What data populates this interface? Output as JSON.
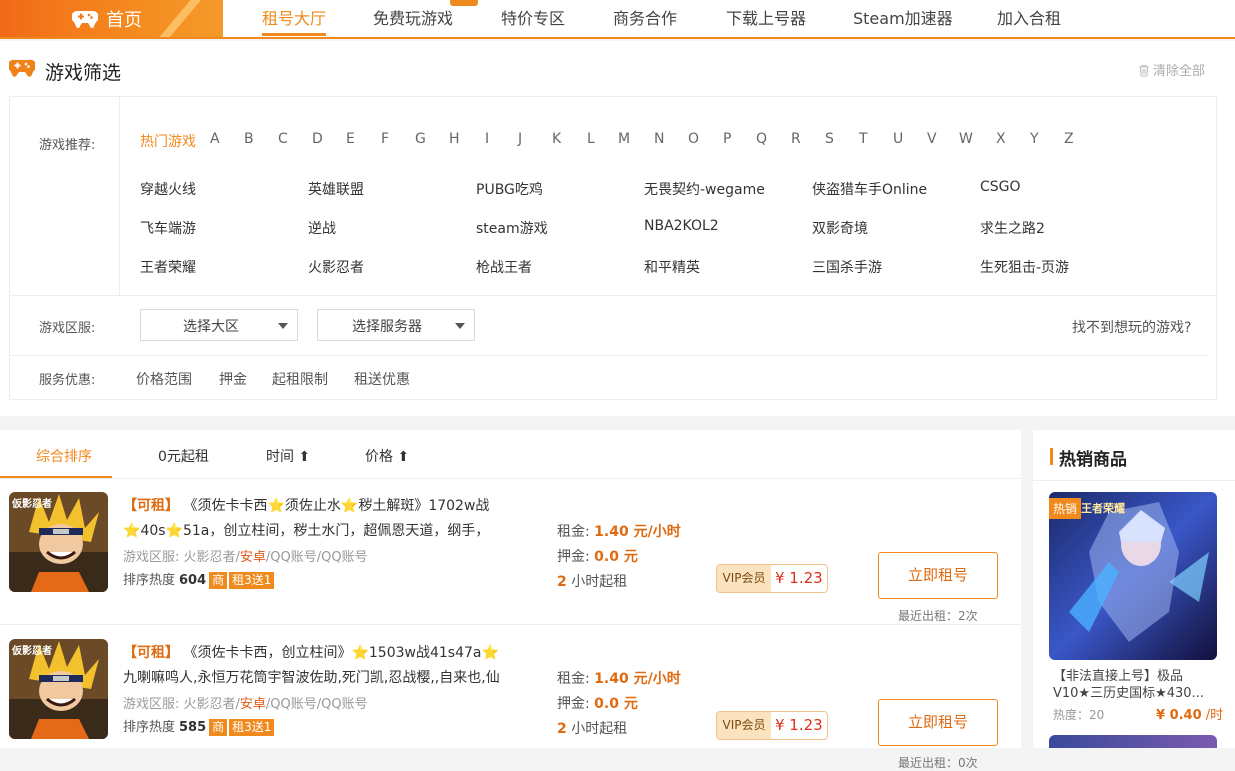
{
  "nav": {
    "home": "首页",
    "items": [
      "租号大厅",
      "免费玩游戏",
      "特价专区",
      "商务合作",
      "下载上号器",
      "Steam加速器",
      "加入合租"
    ],
    "active_index": 0
  },
  "filter": {
    "title": "游戏筛选",
    "clear_all": "清除全部",
    "rec_label": "游戏推荐:",
    "hot_games": "热门游戏",
    "letters": [
      "A",
      "B",
      "C",
      "D",
      "E",
      "F",
      "G",
      "H",
      "I",
      "J",
      "K",
      "L",
      "M",
      "N",
      "O",
      "P",
      "Q",
      "R",
      "S",
      "T",
      "U",
      "V",
      "W",
      "X",
      "Y",
      "Z"
    ],
    "games": [
      [
        "穿越火线",
        "英雄联盟",
        "PUBG吃鸡",
        "无畏契约-wegame",
        "侠盗猎车手Online",
        "CSGO"
      ],
      [
        "飞车端游",
        "逆战",
        "steam游戏",
        "NBA2KOL2",
        "双影奇境",
        "求生之路2"
      ],
      [
        "王者荣耀",
        "火影忍者",
        "枪战王者",
        "和平精英",
        "三国杀手游",
        "生死狙击-页游"
      ]
    ],
    "server_label": "游戏区服:",
    "select_region": "选择大区",
    "select_server": "选择服务器",
    "cant_find": "找不到想玩的游戏?",
    "service_label": "服务优惠:",
    "services": [
      "价格范围",
      "押金",
      "起租限制",
      "租送优惠"
    ]
  },
  "sort": {
    "tabs": [
      "综合排序",
      "0元起租",
      "时间 ⬆",
      "价格 ⬆"
    ]
  },
  "listings": [
    {
      "rent_tag": "【可租】",
      "title_a": "《须佐卡卡西",
      "title_b": "须佐止水",
      "title_c": "秽土解斑》1702w战",
      "line2_a": "40s",
      "line2_b": "51a，创立柱间，秽土水门，超佩恩天道，纲手，",
      "meta_label": "游戏区服: ",
      "meta_game": "火影忍者/",
      "meta_platform": "安卓",
      "meta_rest": "/QQ账号/QQ账号",
      "heat_label": "排序热度",
      "heat_value": "604",
      "tag1": "商",
      "tag2": "租3送1",
      "rent_label": "租金:",
      "rent_value": "1.40 元/小时",
      "deposit_label": "押金:",
      "deposit_value": "0.0 元",
      "min_hours": "2",
      "min_suffix": "小时起租",
      "vip_label": "VIP会员",
      "vip_price": "¥ 1.23",
      "button": "立即租号",
      "recent": "最近出租：2次"
    },
    {
      "rent_tag": "【可租】",
      "title_a": "《须佐卡卡西，创立柱间》",
      "title_b": "1503w战41s47a",
      "title_c": "",
      "line2_a": "",
      "line2_b": "九喇嘛鸣人,永恒万花筒宇智波佐助,死门凯,忍战樱,,自来也,仙",
      "meta_label": "游戏区服: ",
      "meta_game": "火影忍者/",
      "meta_platform": "安卓",
      "meta_rest": "/QQ账号/QQ账号",
      "heat_label": "排序热度",
      "heat_value": "585",
      "tag1": "商",
      "tag2": "租3送1",
      "rent_label": "租金:",
      "rent_value": "1.40 元/小时",
      "deposit_label": "押金:",
      "deposit_value": "0.0 元",
      "min_hours": "2",
      "min_suffix": "小时起租",
      "vip_label": "VIP会员",
      "vip_price": "¥ 1.23",
      "button": "立即租号",
      "recent": "最近出租：0次"
    }
  ],
  "thumb_label": "仮影忍者",
  "hot": {
    "title": "热销商品",
    "badge": "热销",
    "game_tag": "王者荣耀",
    "name": "【非法直接上号】极品V10★三历史国标★430...",
    "heat": "热度：20",
    "price": "¥ 0.40",
    "unit": " /时"
  },
  "colors": {
    "accent": "#f08a1c",
    "price": "#e06a10",
    "vip_price": "#e0301c"
  }
}
